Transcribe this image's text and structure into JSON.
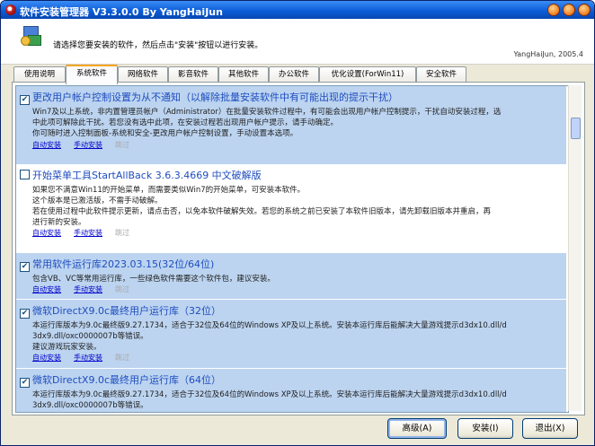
{
  "window": {
    "title": "软件安装管理器 V3.3.0.0 By YangHaiJun"
  },
  "header": {
    "instruction": "请选择您要安装的软件，然后点击\"安装\"按钮以进行安装。",
    "author": "YangHaiJun, 2005.4"
  },
  "tabs": [
    {
      "label": "使用说明",
      "active": false
    },
    {
      "label": "系统软件",
      "active": true
    },
    {
      "label": "网络软件",
      "active": false
    },
    {
      "label": "影音软件",
      "active": false
    },
    {
      "label": "其他软件",
      "active": false
    },
    {
      "label": "办公软件",
      "active": false
    },
    {
      "label": "优化设置(ForWin11)",
      "active": false
    },
    {
      "label": "安全软件",
      "active": false
    }
  ],
  "links": {
    "auto": "自动安装",
    "manual": "手动安装",
    "skip": "跳过"
  },
  "items": [
    {
      "checked": true,
      "title": "更改用户帐户控制设置为从不通知（以解除批量安装软件中有可能出现的提示干扰）",
      "desc": [
        "Win7及以上系统，非内置管理员帐户（Administrator）在批量安装软件过程中，有可能会出现用户帐户控制提示，干扰自动安装过程，选",
        "中此项可解除此干扰。若您没有选中此项，在安装过程若出现用户帐户提示，请手动确定。",
        "你可随时进入控制面板-系统和安全-更改用户帐户控制设置，手动设置本选项。"
      ]
    },
    {
      "checked": false,
      "title": "开始菜单工具StartAllBack 3.6.3.4669 中文破解版",
      "desc": [
        "如果您不满意Win11的开始菜单，而需要类似Win7的开始菜单，可安装本软件。",
        "这个版本是已激活版，不需手动破解。",
        "若在使用过程中此软件提示更新，请点击否，以免本软件破解失效。若您的系统之前已安装了本软件旧版本，请先卸载旧版本并重启，再",
        "进行新的安装。"
      ]
    },
    {
      "checked": true,
      "title": "常用软件运行库2023.03.15(32位/64位)",
      "desc": [
        "包含VB、VC等常用运行库，一些绿色软件需要这个软件包，建议安装。"
      ]
    },
    {
      "checked": true,
      "title": "微软DirectX9.0c最终用户运行库（32位）",
      "desc": [
        "本运行库版本为9.0c最终版9.27.1734，适合于32位及64位的Windows XP及以上系统。安装本运行库后能解决大量游戏提示d3dx10.dll/d",
        "3dx9.dll/oxc0000007b等错误。",
        "建议游戏玩家安装。"
      ]
    },
    {
      "checked": true,
      "title": "微软DirectX9.0c最终用户运行库（64位）",
      "desc": [
        "本运行库版本为9.0c最终版9.27.1734，适合于32位及64位的Windows XP及以上系统。安装本运行库后能解决大量游戏提示d3dx10.dll/d",
        "3dx9.dll/oxc0000007b等错误。"
      ]
    }
  ],
  "buttons": {
    "advanced": "高级(A)",
    "install": "安装(I)",
    "exit": "退出(X)"
  }
}
